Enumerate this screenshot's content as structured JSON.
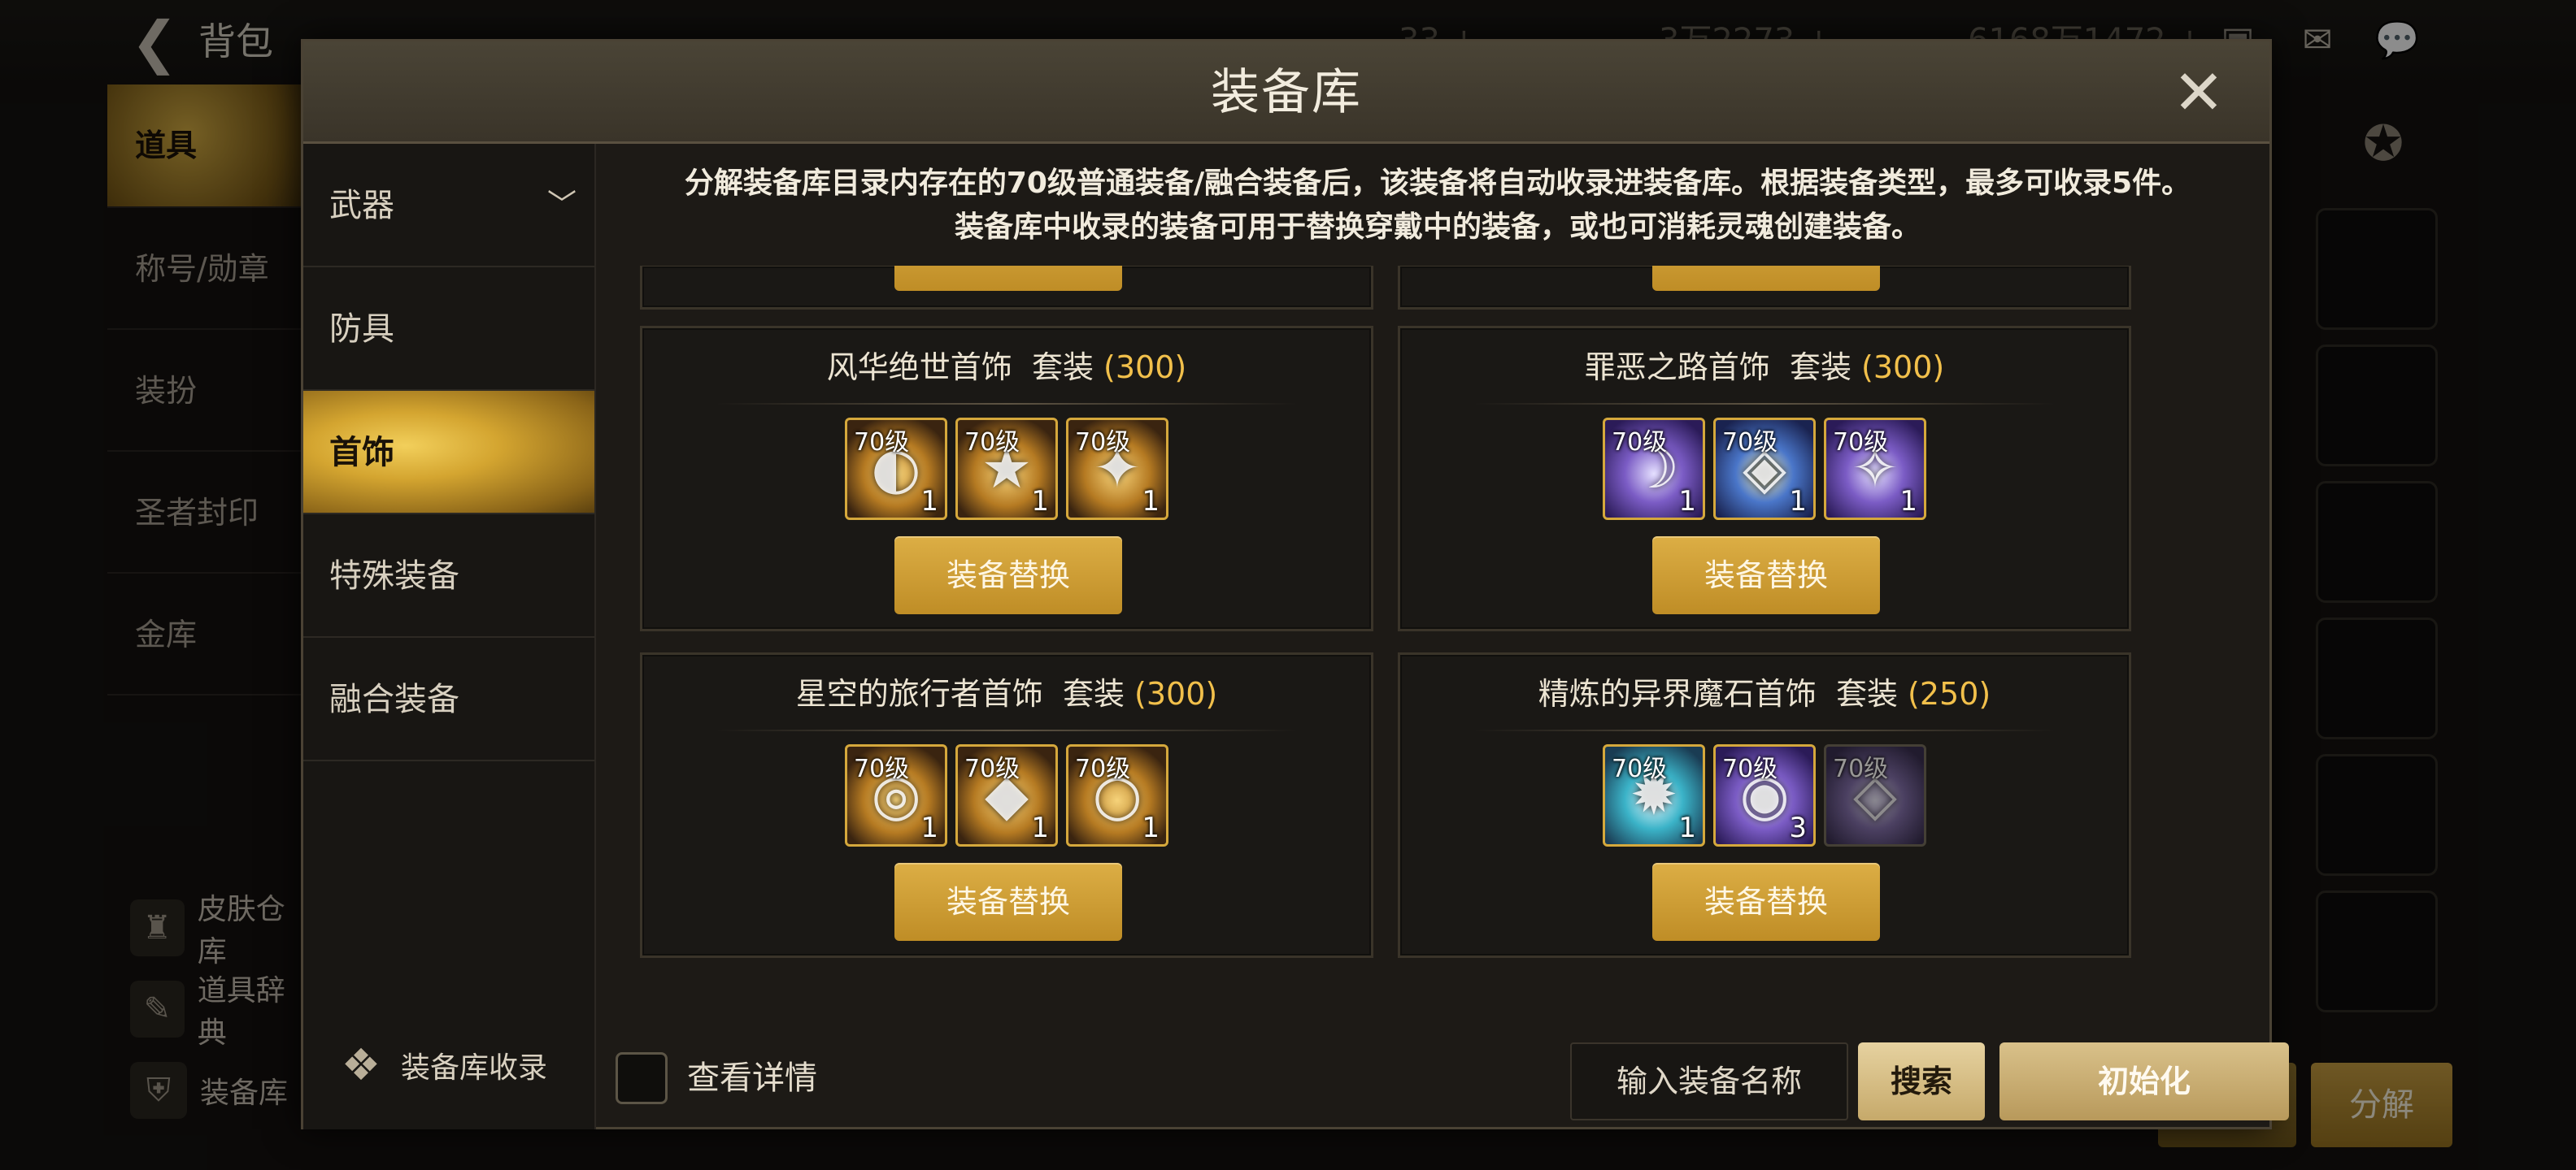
{
  "background": {
    "title": "背包",
    "currencies": [
      "33 +",
      "3万2273 +",
      "6168万1472 +"
    ],
    "left_menu": [
      "道具",
      "称号/勋章",
      "装扮",
      "圣者封印",
      "金库"
    ],
    "left_bottom": [
      "皮肤仓库",
      "道具辞典",
      "装备库"
    ],
    "decompose_label": "分解"
  },
  "modal": {
    "title": "装备库",
    "close_label": "✕",
    "notice_line1_a": "分解装备库目录内存在的70级普通装备/融合装备",
    "notice_line1_b": "后，该装备将自动收录进装备库。根据装备类型，最多可收录5件。",
    "notice_line2": "装备库中收录的装备可用于替换穿戴中的装备，或也可消耗灵魂创建装备。",
    "sidebar": {
      "items": [
        {
          "label": "武器"
        },
        {
          "label": "防具"
        },
        {
          "label": "首饰"
        },
        {
          "label": "特殊装备"
        },
        {
          "label": "融合装备"
        }
      ],
      "footer_label": "装备库收录"
    },
    "sets": [
      {
        "name": "风华绝世首饰",
        "suffix": "套装",
        "count": "(300)",
        "items": [
          {
            "level": "70级",
            "qty": "1",
            "style": "gold",
            "glyph": "◐"
          },
          {
            "level": "70级",
            "qty": "1",
            "style": "gold",
            "glyph": "★"
          },
          {
            "level": "70级",
            "qty": "1",
            "style": "gold",
            "glyph": "✦"
          }
        ]
      },
      {
        "name": "罪恶之路首饰",
        "suffix": "套装",
        "count": "(300)",
        "items": [
          {
            "level": "70级",
            "qty": "1",
            "style": "purple",
            "glyph": "☽"
          },
          {
            "level": "70级",
            "qty": "1",
            "style": "blue",
            "glyph": "◈"
          },
          {
            "level": "70级",
            "qty": "1",
            "style": "purple",
            "glyph": "✧"
          }
        ]
      },
      {
        "name": "星空的旅行者首饰",
        "suffix": "套装",
        "count": "(300)",
        "items": [
          {
            "level": "70级",
            "qty": "1",
            "style": "gold",
            "glyph": "◎"
          },
          {
            "level": "70级",
            "qty": "1",
            "style": "gold",
            "glyph": "◆"
          },
          {
            "level": "70级",
            "qty": "1",
            "style": "gold",
            "glyph": "○"
          }
        ]
      },
      {
        "name": "精炼的异界魔石首饰",
        "suffix": "套装",
        "count": "(250)",
        "items": [
          {
            "level": "70级",
            "qty": "1",
            "style": "teal",
            "glyph": "✹"
          },
          {
            "level": "70级",
            "qty": "3",
            "style": "purple",
            "glyph": "◉"
          },
          {
            "level": "70级",
            "qty": "",
            "style": "purple dim-item",
            "glyph": "◇"
          }
        ]
      }
    ],
    "replace_label": "装备替换",
    "footer": {
      "checkbox_label": "查看详情",
      "search_placeholder": "输入装备名称",
      "search_label": "搜索",
      "init_label": "初始化"
    }
  }
}
